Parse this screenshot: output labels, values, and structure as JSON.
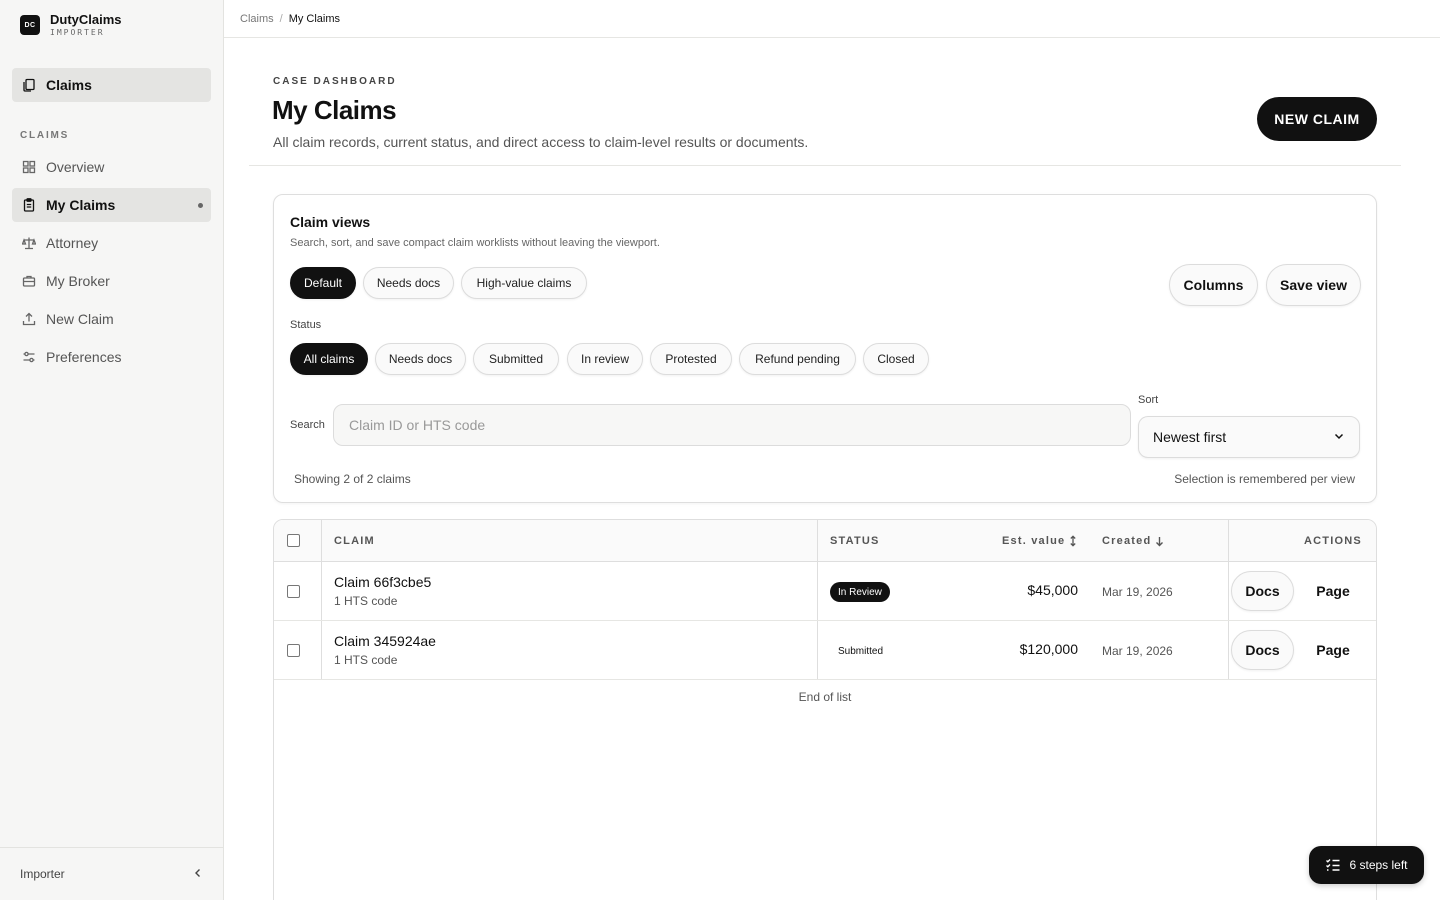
{
  "brand": {
    "logo": "DC",
    "name": "DutyClaims",
    "sub": "IMPORTER"
  },
  "sidebar": {
    "top_item": {
      "label": "Claims",
      "icon": "document-copy-icon"
    },
    "section_label": "CLAIMS",
    "items": [
      {
        "label": "Overview",
        "icon": "grid-icon",
        "active": false
      },
      {
        "label": "My Claims",
        "icon": "clipboard-icon",
        "active": true
      },
      {
        "label": "Attorney",
        "icon": "scale-icon",
        "active": false
      },
      {
        "label": "My Broker",
        "icon": "briefcase-icon",
        "active": false
      },
      {
        "label": "New Claim",
        "icon": "upload-icon",
        "active": false
      },
      {
        "label": "Preferences",
        "icon": "sliders-icon",
        "active": false
      }
    ],
    "footer_label": "Importer"
  },
  "breadcrumb": {
    "parent": "Claims",
    "separator": "/",
    "current": "My Claims"
  },
  "header": {
    "eyebrow": "CASE DASHBOARD",
    "title": "My Claims",
    "subtitle": "All claim records, current status, and direct access to claim-level results or documents.",
    "primary_button": "NEW CLAIM"
  },
  "views": {
    "title": "Claim views",
    "subtitle": "Search, sort, and save compact claim worklists without leaving the viewport.",
    "presets": [
      "Default",
      "Needs docs",
      "High-value claims"
    ],
    "active_preset": "Default",
    "columns_button": "Columns",
    "save_button": "Save view",
    "status_label": "Status",
    "statuses": [
      "All claims",
      "Needs docs",
      "Submitted",
      "In review",
      "Protested",
      "Refund pending",
      "Closed"
    ],
    "active_status": "All claims",
    "search_label": "Search",
    "search_placeholder": "Claim ID or HTS code",
    "search_value": "",
    "sort_label": "Sort",
    "sort_value": "Newest first",
    "showing": "Showing 2 of 2 claims",
    "remember_note": "Selection is remembered per view"
  },
  "table": {
    "columns": {
      "claim": "CLAIM",
      "status": "STATUS",
      "value": "Est. value",
      "created": "Created",
      "actions": "ACTIONS"
    },
    "rows": [
      {
        "name": "Claim 66f3cbe5",
        "meta": "1 HTS code",
        "status": "In Review",
        "status_style": "dark",
        "value": "$45,000",
        "created": "Mar 19, 2026",
        "docs": "Docs",
        "page": "Page"
      },
      {
        "name": "Claim 345924ae",
        "meta": "1 HTS code",
        "status": "Submitted",
        "status_style": "plain",
        "value": "$120,000",
        "created": "Mar 19, 2026",
        "docs": "Docs",
        "page": "Page"
      }
    ],
    "end_label": "End of list"
  },
  "steps": {
    "label": "6 steps left",
    "icon": "checklist-icon"
  },
  "colors": {
    "accent": "#111111",
    "sidebar_bg": "#f6f6f5",
    "active_bg": "#e4e4e2",
    "border": "#dedede"
  }
}
